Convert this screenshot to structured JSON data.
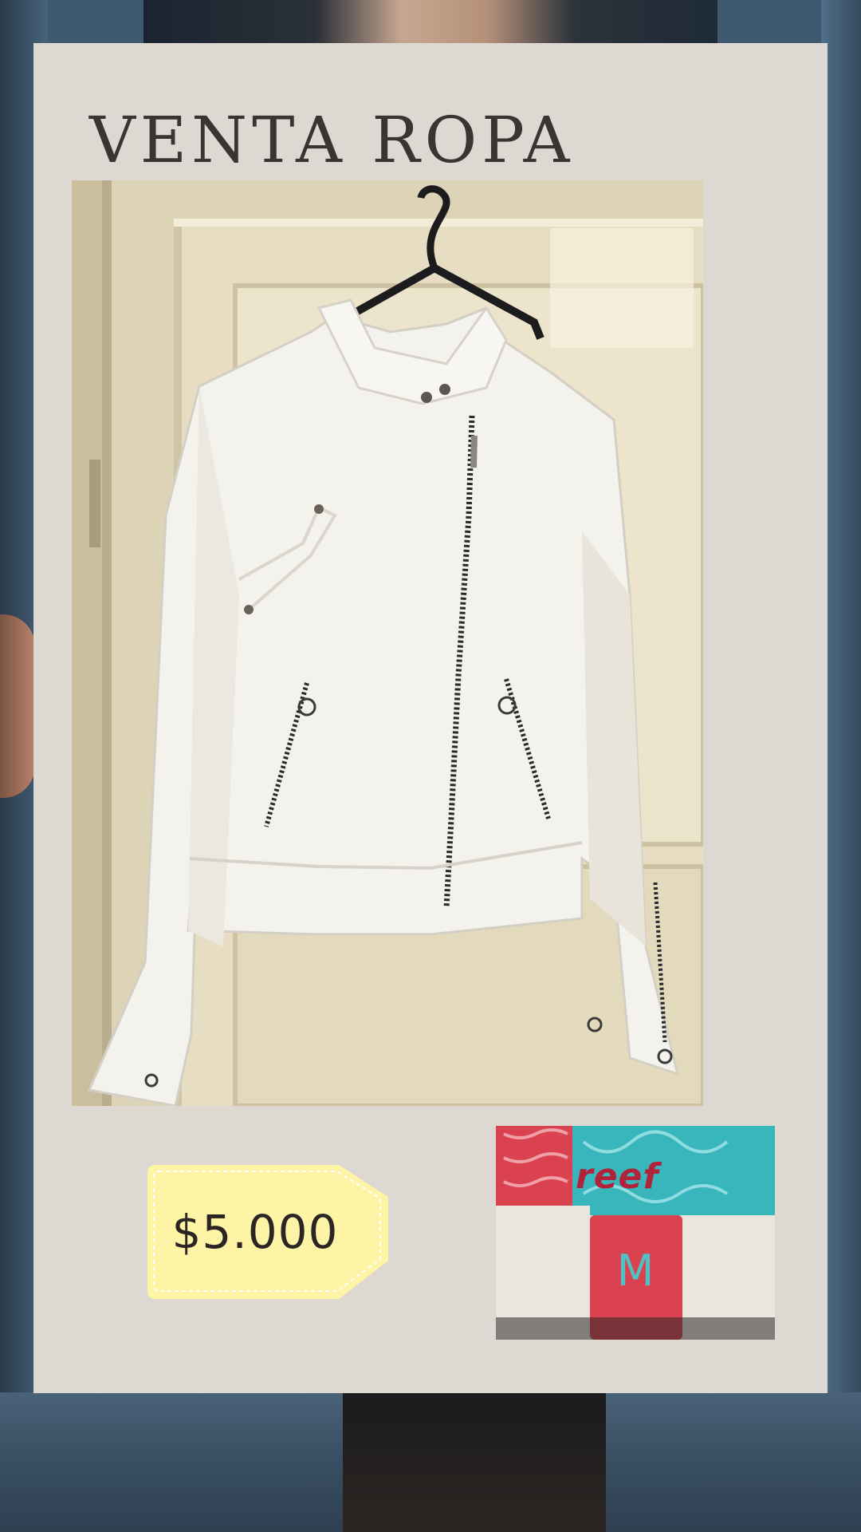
{
  "poster": {
    "title": "VENTA ROPA",
    "price": "$5.000",
    "label": {
      "brand": "reef",
      "size": "M"
    }
  },
  "colors": {
    "card_background": "#ddd8d2",
    "price_tag_fill": "#fdf4a6",
    "label_red": "#d9424e",
    "label_teal": "#39b6bc"
  }
}
